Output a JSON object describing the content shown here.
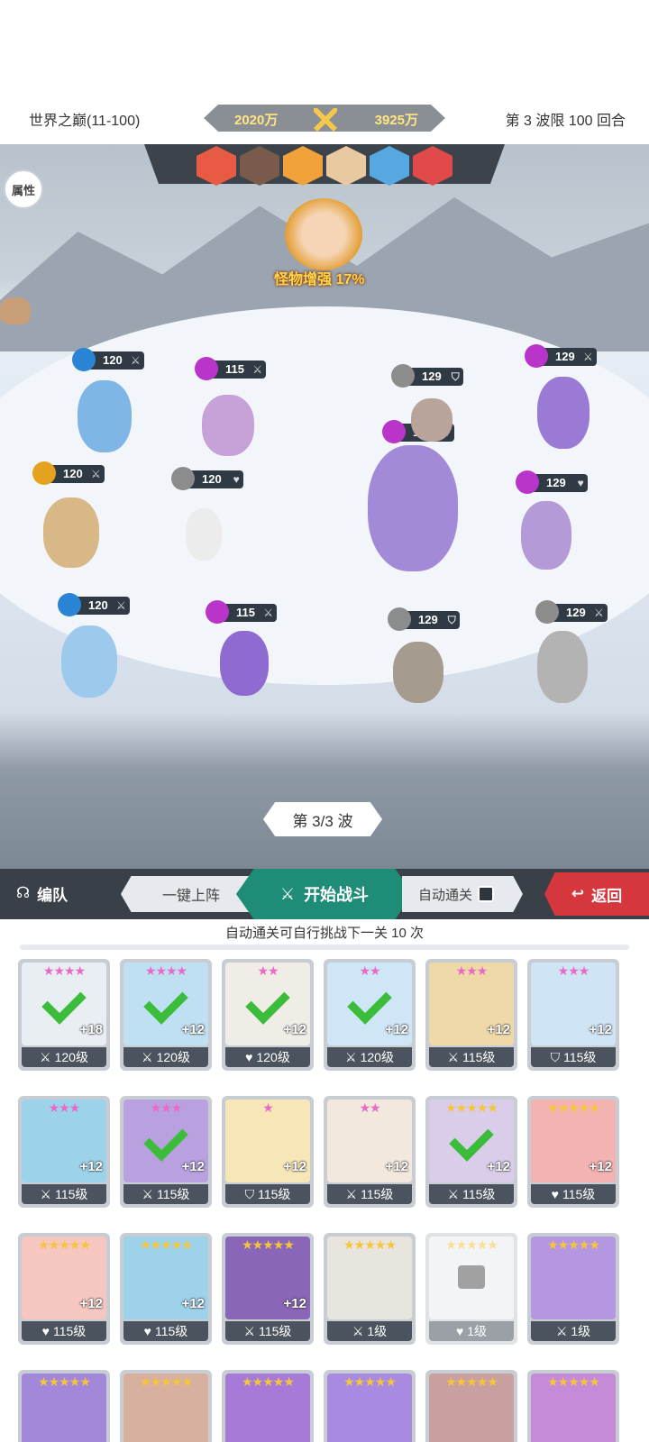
{
  "header": {
    "stage_name": "世界之巅(11-100)",
    "power_left": "2020万",
    "power_right": "3925万",
    "wave_limit": "第 3 波限 100 回合"
  },
  "battle": {
    "attr_button": "属性",
    "boss_buff": "怪物增强 17%",
    "wave_indicator": "第 3/3 波",
    "enemy_icon_colors": [
      "#e85a43",
      "#7a5a4a",
      "#f2a23b",
      "#e8c9a0",
      "#55a9e0",
      "#e04a4a"
    ],
    "units": [
      {
        "level": "120",
        "element": "water-icon",
        "type": "sword-icon"
      },
      {
        "level": "115",
        "element": "moon-icon",
        "type": "sword-icon"
      },
      {
        "level": "120",
        "element": "wind-icon",
        "type": "sword-icon"
      },
      {
        "level": "120",
        "element": "sun-icon",
        "type": "heart-icon"
      },
      {
        "level": "120",
        "element": "water-icon",
        "type": "sword-icon"
      },
      {
        "level": "115",
        "element": "moon-icon",
        "type": "sword-icon"
      },
      {
        "level": "129",
        "element": "sun-icon",
        "type": "shield-icon"
      },
      {
        "level": "129",
        "element": "moon-icon",
        "type": "heart-icon"
      },
      {
        "level": "129",
        "element": "moon-icon",
        "type": "sword-icon"
      },
      {
        "level": "129",
        "element": "moon-icon",
        "type": "heart-icon"
      },
      {
        "level": "129",
        "element": "sun-icon",
        "type": "shield-icon"
      },
      {
        "level": "129",
        "element": "sun-icon",
        "type": "sword-icon"
      }
    ]
  },
  "actions": {
    "team": "编队",
    "one_click": "一键上阵",
    "start_battle": "开始战斗",
    "auto_clear": "自动通关",
    "back": "返回"
  },
  "auto_note": "自动通关可自行挑战下一关 10 次",
  "heroes": [
    {
      "stars": "★★★★",
      "plus": "+18",
      "level": "120级",
      "type": "sword",
      "checked": true,
      "color": "#e9eef3"
    },
    {
      "stars": "★★★★",
      "plus": "+12",
      "level": "120级",
      "type": "sword",
      "checked": true,
      "color": "#bfe0f2"
    },
    {
      "stars": "★★",
      "plus": "+12",
      "level": "120级",
      "type": "heart",
      "checked": true,
      "color": "#f0ece6"
    },
    {
      "stars": "★★",
      "plus": "+12",
      "level": "120级",
      "type": "sword",
      "checked": true,
      "color": "#cfe6f6"
    },
    {
      "stars": "★★★",
      "plus": "+12",
      "level": "115级",
      "type": "sword",
      "checked": false,
      "color": "#f0d9a8"
    },
    {
      "stars": "★★★",
      "plus": "+12",
      "level": "115级",
      "type": "shield",
      "checked": false,
      "color": "#cfe4f5"
    },
    {
      "stars": "★★★",
      "plus": "+12",
      "level": "115级",
      "type": "sword",
      "checked": false,
      "color": "#9dd3ea"
    },
    {
      "stars": "★★★",
      "plus": "+12",
      "level": "115级",
      "type": "sword",
      "checked": true,
      "color": "#b9a1e0"
    },
    {
      "stars": "★",
      "plus": "+12",
      "level": "115级",
      "type": "shield",
      "checked": false,
      "color": "#f7e6b8"
    },
    {
      "stars": "★★",
      "plus": "+12",
      "level": "115级",
      "type": "sword",
      "checked": false,
      "color": "#f3e8dd"
    },
    {
      "stars": "★★★★★",
      "plus": "+12",
      "level": "115级",
      "type": "sword",
      "checked": true,
      "color": "#d9cdea"
    },
    {
      "stars": "★★★★★",
      "plus": "+12",
      "level": "115级",
      "type": "heart",
      "checked": false,
      "color": "#f3b3b3"
    },
    {
      "stars": "★★★★★",
      "plus": "+12",
      "level": "115级",
      "type": "heart",
      "checked": false,
      "color": "#f6c6c0"
    },
    {
      "stars": "★★★★★",
      "plus": "+12",
      "level": "115级",
      "type": "heart",
      "checked": false,
      "color": "#9ed1ea"
    },
    {
      "stars": "★★★★★",
      "plus": "+12",
      "level": "115级",
      "type": "sword",
      "checked": false,
      "color": "#8a66b8"
    },
    {
      "stars": "★★★★★",
      "plus": "",
      "level": "1级",
      "type": "sword",
      "checked": false,
      "color": "#e8e5df"
    },
    {
      "stars": "★★★★★",
      "plus": "",
      "level": "1级",
      "type": "heart",
      "checked": false,
      "locked": true,
      "color": "#e9ecef"
    },
    {
      "stars": "★★★★★",
      "plus": "",
      "level": "1级",
      "type": "sword",
      "checked": false,
      "color": "#b497e0"
    },
    {
      "stars": "★★★★★",
      "plus": "",
      "level": "",
      "type": "",
      "checked": false,
      "color": "#a388d9"
    },
    {
      "stars": "★★★★★",
      "plus": "",
      "level": "",
      "type": "",
      "checked": false,
      "color": "#d7b0a0"
    },
    {
      "stars": "★★★★★",
      "plus": "",
      "level": "",
      "type": "",
      "checked": false,
      "color": "#a67ad6"
    },
    {
      "stars": "★★★★★",
      "plus": "",
      "level": "",
      "type": "",
      "checked": false,
      "color": "#a88be0"
    },
    {
      "stars": "★★★★★",
      "plus": "",
      "level": "",
      "type": "",
      "checked": false,
      "color": "#c9a0a0"
    },
    {
      "stars": "★★★★★",
      "plus": "",
      "level": "",
      "type": "",
      "checked": false,
      "color": "#c58ad8"
    }
  ]
}
